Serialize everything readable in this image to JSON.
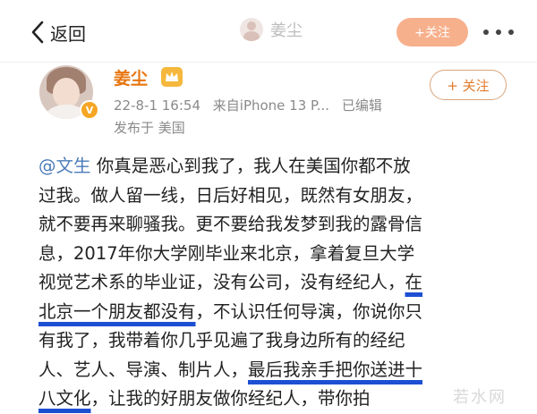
{
  "nav": {
    "back_label": "返回",
    "title": "姜尘",
    "follow_label": "+关注",
    "back_icon": "chevron-left-icon",
    "more_icon": "more-dots-icon"
  },
  "post": {
    "author": "姜尘",
    "verified_badge": "V",
    "time": "22-8-1 16:54",
    "source": "来自iPhone 13 P...",
    "edited": "已编辑",
    "location": "发布于 美国",
    "follow_label": "+ 关注",
    "accent_color": "#e8750e",
    "lines": [
      [
        {
          "t": "@文生",
          "c": "mention"
        },
        {
          "t": " 你真是恶心到我了，我人在美国你都不放",
          "c": ""
        }
      ],
      [
        {
          "t": "过我。做人留一线，日后好相见，既然有女朋友，",
          "c": ""
        }
      ],
      [
        {
          "t": "就不要再来聊骚我。更不要给我发梦到我的露骨信",
          "c": ""
        }
      ],
      [
        {
          "t": "息，2017年你大学刚毕业来北京，拿着复旦大学",
          "c": ""
        }
      ],
      [
        {
          "t": "视觉艺术系的毕业证，没有公司，没有经纪人，",
          "c": ""
        },
        {
          "t": "在",
          "c": "ul"
        }
      ],
      [
        {
          "t": "北京一个朋友都没有",
          "c": "ul"
        },
        {
          "t": "，不认识任何导演，你说你只",
          "c": ""
        }
      ],
      [
        {
          "t": "有我了，我带着你几乎见遍了我身边所有的经纪",
          "c": ""
        }
      ],
      [
        {
          "t": "人、艺人、导演、制片人，",
          "c": ""
        },
        {
          "t": "最后我亲手把你送进十",
          "c": "ul"
        }
      ],
      [
        {
          "t": "八文化",
          "c": "ul"
        },
        {
          "t": "，让我的好朋友做你经纪人，带你拍",
          "c": ""
        }
      ]
    ]
  },
  "watermark": "若水网"
}
